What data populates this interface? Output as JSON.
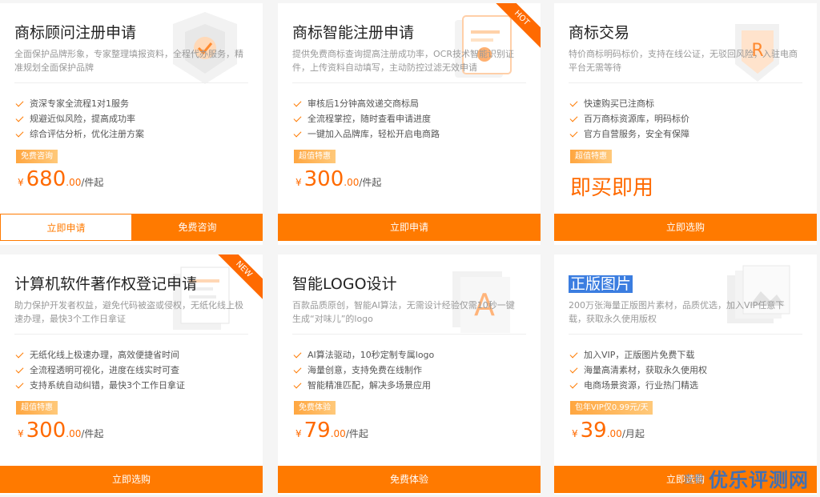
{
  "cards": [
    {
      "title": "商标顾问注册申请",
      "desc": "全面保护品牌形象，专家整理填报资料，全程代办服务，精准规划全面保护品牌",
      "features": [
        "资深专家全流程1对1服务",
        "规避近似风险，提高成功率",
        "综合评估分析，优化注册方案"
      ],
      "badge": "免费咨询",
      "currency": "¥",
      "price": "680",
      "decimal": ".00",
      "unit": "/件起",
      "buttons": [
        "立即申请",
        "免费咨询"
      ]
    },
    {
      "title": "商标智能注册申请",
      "ribbon": "HOT",
      "desc": "提供免费商标查询提高注册成功率，OCR技术智能识别证件，上传资料自动填写，主动防控过滤无效申请",
      "features": [
        "审核后1分钟高效递交商标局",
        "全流程掌控，随时查看申请进度",
        "一键加入品牌库，轻松开启电商路"
      ],
      "badge": "超值特惠",
      "currency": "¥",
      "price": "300",
      "decimal": ".00",
      "unit": "/件起",
      "buttons": [
        "立即申请"
      ]
    },
    {
      "title": "商标交易",
      "desc": "特价商标明码标价，支持在线公证，无驳回风险，入驻电商平台无需等待",
      "features": [
        "快速购买已注商标",
        "百万商标资源库，明码标价",
        "官方自营服务，安全有保障"
      ],
      "badge": "超值特惠",
      "big": "即买即用",
      "buttons": [
        "立即选购"
      ]
    },
    {
      "title": "计算机软件著作权登记申请",
      "ribbon": "NEW",
      "desc": "助力保护开发者权益，避免代码被盗或侵权，无纸化线上极速办理，最快3个工作日拿证",
      "features": [
        "无纸化线上极速办理，高效便捷省时间",
        "全流程透明可视化，进度在线实时可查",
        "支持系统自动纠错，最快3个工作日拿证"
      ],
      "badge": "超值特惠",
      "currency": "¥",
      "price": "300",
      "decimal": ".00",
      "unit": "/件起",
      "buttons": [
        "立即选购"
      ]
    },
    {
      "title": "智能LOGO设计",
      "desc": "百款品质原创，智能AI算法，无需设计经验仅需10秒一键生成“对味儿”的logo",
      "features": [
        "AI算法驱动，10秒定制专属logo",
        "海量创意，支持免费在线制作",
        "智能精准匹配，解决多场景应用"
      ],
      "badge": "免费体验",
      "currency": "¥",
      "price": "79",
      "decimal": ".00",
      "unit": "/件起",
      "buttons": [
        "免费体验"
      ]
    },
    {
      "title": "正版图片",
      "desc": "200万张海量正版图片素材，品质优选，加入VIP任意下载，获取永久使用版权",
      "features": [
        "加入VIP，正版图片免费下载",
        "海量高清素材，获取永久使用权",
        "电商场景资源，行业热门精选"
      ],
      "badge": "包年VIP仅0.99元/天",
      "currency": "¥",
      "price": "39",
      "decimal": ".00",
      "unit": "/月起",
      "buttons": [
        "立即选购"
      ]
    }
  ],
  "watermark": {
    "small": "查看",
    "big": "优乐评测网"
  },
  "colors": {
    "accent": "#ff7a00",
    "price": "#ff6a00"
  }
}
